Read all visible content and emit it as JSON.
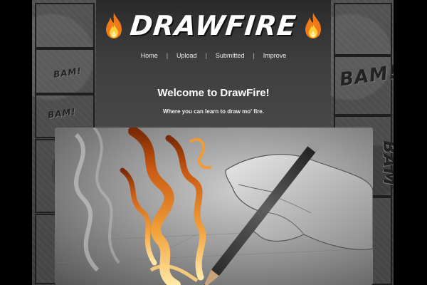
{
  "site": {
    "title": "DRAWFIRE",
    "logo_icon": "flame-icon"
  },
  "nav": {
    "items": [
      {
        "label": "Home"
      },
      {
        "label": "Upload"
      },
      {
        "label": "Submitted"
      },
      {
        "label": "Improve"
      }
    ],
    "separator": "|"
  },
  "hero_text": {
    "welcome": "Welcome to DrawFire!",
    "tagline": "Where you can learn to draw mo' fire."
  },
  "background": {
    "comic_words": [
      "BAM!",
      "BAM!",
      "BAM!",
      "BAM"
    ]
  },
  "colors": {
    "page_bg": "#000000",
    "content_bg": "#3f3f3f",
    "flame_orange": "#f07a1a",
    "text": "#ffffff"
  }
}
